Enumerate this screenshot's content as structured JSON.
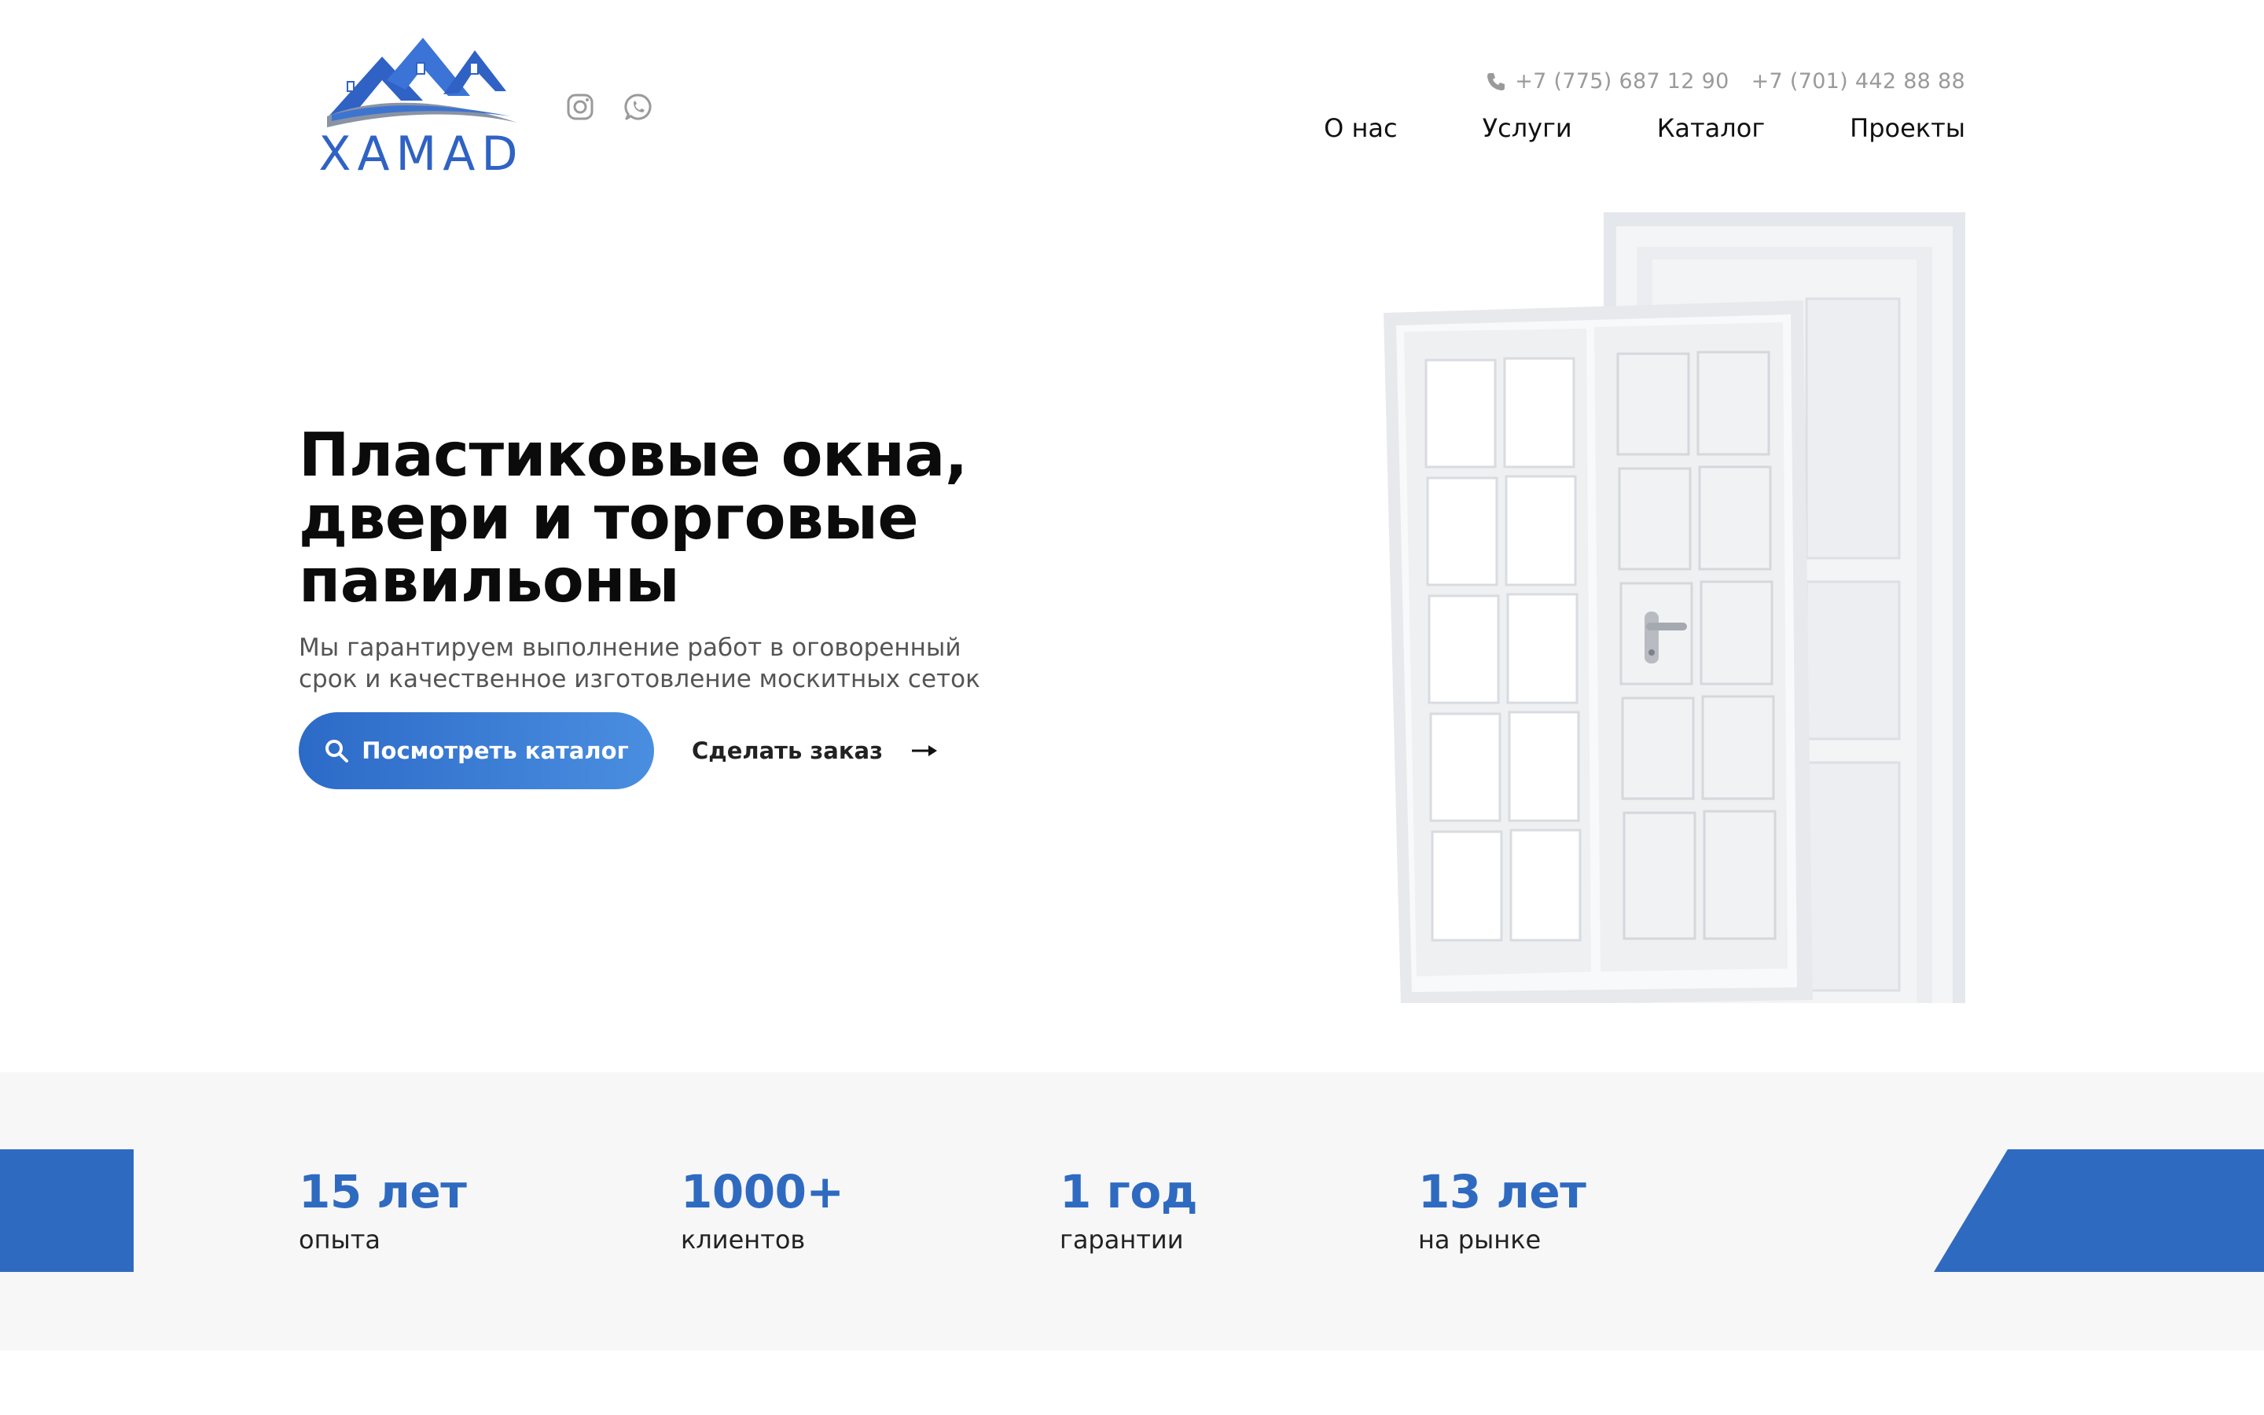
{
  "header": {
    "logo_text": "XAMAD",
    "phones": [
      "+7 (775) 687 12 90",
      "+7 (701) 442 88 88"
    ],
    "nav": [
      "О нас",
      "Услуги",
      "Каталог",
      "Проекты"
    ]
  },
  "hero": {
    "title_lines": [
      "Пластиковые окна,",
      "двери и торговые",
      "павильоны"
    ],
    "subtitle_lines": [
      "Мы гарантируем выполнение работ в оговоренный",
      "срок и качественное изготовление москитных сеток"
    ],
    "primary_button": "Посмотреть каталог",
    "secondary_button": "Сделать заказ"
  },
  "stats": [
    {
      "value": "15 лет",
      "label": "опыта"
    },
    {
      "value": "1000+",
      "label": "клиентов"
    },
    {
      "value": "1 год",
      "label": "гарантии"
    },
    {
      "value": "13 лет",
      "label": "на рынке"
    }
  ],
  "colors": {
    "accent": "#2f6ac1",
    "button_gradient_start": "#2c6ac7",
    "button_gradient_end": "#4a8ee0",
    "stats_background": "#f7f7f7",
    "muted_text": "#9a9a9a"
  },
  "icons": {
    "social": [
      "instagram-icon",
      "whatsapp-icon"
    ],
    "phone": "phone-icon",
    "search": "search-icon",
    "arrow": "arrow-right-icon"
  }
}
